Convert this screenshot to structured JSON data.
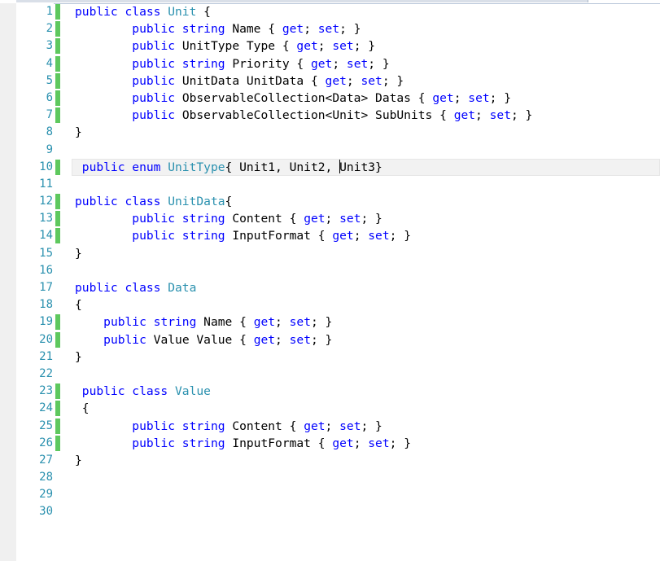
{
  "editor": {
    "lines": [
      {
        "n": "1",
        "changed": true,
        "tokens": [
          {
            "t": "public class ",
            "c": "kw"
          },
          {
            "t": "Unit",
            "c": "ty"
          },
          {
            "t": " {",
            "c": "pl"
          }
        ]
      },
      {
        "n": "2",
        "changed": true,
        "tokens": [
          {
            "t": "        ",
            "c": "pl"
          },
          {
            "t": "public string ",
            "c": "kw"
          },
          {
            "t": "Name { ",
            "c": "pl"
          },
          {
            "t": "get",
            "c": "kw"
          },
          {
            "t": "; ",
            "c": "pl"
          },
          {
            "t": "set",
            "c": "kw"
          },
          {
            "t": "; }",
            "c": "pl"
          }
        ]
      },
      {
        "n": "3",
        "changed": true,
        "tokens": [
          {
            "t": "        ",
            "c": "pl"
          },
          {
            "t": "public ",
            "c": "kw"
          },
          {
            "t": "UnitType Type { ",
            "c": "pl"
          },
          {
            "t": "get",
            "c": "kw"
          },
          {
            "t": "; ",
            "c": "pl"
          },
          {
            "t": "set",
            "c": "kw"
          },
          {
            "t": "; }",
            "c": "pl"
          }
        ]
      },
      {
        "n": "4",
        "changed": true,
        "tokens": [
          {
            "t": "        ",
            "c": "pl"
          },
          {
            "t": "public string ",
            "c": "kw"
          },
          {
            "t": "Priority { ",
            "c": "pl"
          },
          {
            "t": "get",
            "c": "kw"
          },
          {
            "t": "; ",
            "c": "pl"
          },
          {
            "t": "set",
            "c": "kw"
          },
          {
            "t": "; }",
            "c": "pl"
          }
        ]
      },
      {
        "n": "5",
        "changed": true,
        "tokens": [
          {
            "t": "        ",
            "c": "pl"
          },
          {
            "t": "public ",
            "c": "kw"
          },
          {
            "t": "UnitData UnitData { ",
            "c": "pl"
          },
          {
            "t": "get",
            "c": "kw"
          },
          {
            "t": "; ",
            "c": "pl"
          },
          {
            "t": "set",
            "c": "kw"
          },
          {
            "t": "; }",
            "c": "pl"
          }
        ]
      },
      {
        "n": "6",
        "changed": true,
        "tokens": [
          {
            "t": "        ",
            "c": "pl"
          },
          {
            "t": "public ",
            "c": "kw"
          },
          {
            "t": "ObservableCollection<Data> Datas { ",
            "c": "pl"
          },
          {
            "t": "get",
            "c": "kw"
          },
          {
            "t": "; ",
            "c": "pl"
          },
          {
            "t": "set",
            "c": "kw"
          },
          {
            "t": "; }",
            "c": "pl"
          }
        ]
      },
      {
        "n": "7",
        "changed": true,
        "tokens": [
          {
            "t": "        ",
            "c": "pl"
          },
          {
            "t": "public ",
            "c": "kw"
          },
          {
            "t": "ObservableCollection<Unit> SubUnits { ",
            "c": "pl"
          },
          {
            "t": "get",
            "c": "kw"
          },
          {
            "t": "; ",
            "c": "pl"
          },
          {
            "t": "set",
            "c": "kw"
          },
          {
            "t": "; }",
            "c": "pl"
          }
        ]
      },
      {
        "n": "8",
        "changed": false,
        "tokens": [
          {
            "t": "}",
            "c": "pl"
          }
        ]
      },
      {
        "n": "9",
        "changed": false,
        "tokens": []
      },
      {
        "n": "10",
        "changed": true,
        "current": true,
        "tokens": [
          {
            "t": " public enum ",
            "c": "kw"
          },
          {
            "t": "UnitType",
            "c": "ty"
          },
          {
            "t": "{ Unit1, Unit2, ",
            "c": "pl"
          },
          {
            "t": "",
            "c": "caret"
          },
          {
            "t": "Unit3}",
            "c": "pl"
          }
        ]
      },
      {
        "n": "11",
        "changed": false,
        "tokens": []
      },
      {
        "n": "12",
        "changed": true,
        "tokens": [
          {
            "t": "public class ",
            "c": "kw"
          },
          {
            "t": "UnitData",
            "c": "ty"
          },
          {
            "t": "{",
            "c": "pl"
          }
        ]
      },
      {
        "n": "13",
        "changed": true,
        "tokens": [
          {
            "t": "        ",
            "c": "pl"
          },
          {
            "t": "public string ",
            "c": "kw"
          },
          {
            "t": "Content { ",
            "c": "pl"
          },
          {
            "t": "get",
            "c": "kw"
          },
          {
            "t": "; ",
            "c": "pl"
          },
          {
            "t": "set",
            "c": "kw"
          },
          {
            "t": "; }",
            "c": "pl"
          }
        ]
      },
      {
        "n": "14",
        "changed": true,
        "tokens": [
          {
            "t": "        ",
            "c": "pl"
          },
          {
            "t": "public string ",
            "c": "kw"
          },
          {
            "t": "InputFormat { ",
            "c": "pl"
          },
          {
            "t": "get",
            "c": "kw"
          },
          {
            "t": "; ",
            "c": "pl"
          },
          {
            "t": "set",
            "c": "kw"
          },
          {
            "t": "; }",
            "c": "pl"
          }
        ]
      },
      {
        "n": "15",
        "changed": false,
        "tokens": [
          {
            "t": "}",
            "c": "pl"
          }
        ]
      },
      {
        "n": "16",
        "changed": false,
        "tokens": []
      },
      {
        "n": "17",
        "changed": false,
        "tokens": [
          {
            "t": "public class ",
            "c": "kw"
          },
          {
            "t": "Data",
            "c": "ty"
          }
        ]
      },
      {
        "n": "18",
        "changed": false,
        "tokens": [
          {
            "t": "{",
            "c": "pl"
          }
        ]
      },
      {
        "n": "19",
        "changed": true,
        "tokens": [
          {
            "t": "    ",
            "c": "pl"
          },
          {
            "t": "public string ",
            "c": "kw"
          },
          {
            "t": "Name { ",
            "c": "pl"
          },
          {
            "t": "get",
            "c": "kw"
          },
          {
            "t": "; ",
            "c": "pl"
          },
          {
            "t": "set",
            "c": "kw"
          },
          {
            "t": "; }",
            "c": "pl"
          }
        ]
      },
      {
        "n": "20",
        "changed": true,
        "tokens": [
          {
            "t": "    ",
            "c": "pl"
          },
          {
            "t": "public ",
            "c": "kw"
          },
          {
            "t": "Value Value { ",
            "c": "pl"
          },
          {
            "t": "get",
            "c": "kw"
          },
          {
            "t": "; ",
            "c": "pl"
          },
          {
            "t": "set",
            "c": "kw"
          },
          {
            "t": "; }",
            "c": "pl"
          }
        ]
      },
      {
        "n": "21",
        "changed": false,
        "tokens": [
          {
            "t": "}",
            "c": "pl"
          }
        ]
      },
      {
        "n": "22",
        "changed": false,
        "tokens": []
      },
      {
        "n": "23",
        "changed": true,
        "tokens": [
          {
            "t": " public class ",
            "c": "kw"
          },
          {
            "t": "Value",
            "c": "ty"
          }
        ]
      },
      {
        "n": "24",
        "changed": true,
        "tokens": [
          {
            "t": " {",
            "c": "pl"
          }
        ]
      },
      {
        "n": "25",
        "changed": true,
        "tokens": [
          {
            "t": "        ",
            "c": "pl"
          },
          {
            "t": "public string ",
            "c": "kw"
          },
          {
            "t": "Content { ",
            "c": "pl"
          },
          {
            "t": "get",
            "c": "kw"
          },
          {
            "t": "; ",
            "c": "pl"
          },
          {
            "t": "set",
            "c": "kw"
          },
          {
            "t": "; }",
            "c": "pl"
          }
        ]
      },
      {
        "n": "26",
        "changed": true,
        "tokens": [
          {
            "t": "        ",
            "c": "pl"
          },
          {
            "t": "public string ",
            "c": "kw"
          },
          {
            "t": "InputFormat { ",
            "c": "pl"
          },
          {
            "t": "get",
            "c": "kw"
          },
          {
            "t": "; ",
            "c": "pl"
          },
          {
            "t": "set",
            "c": "kw"
          },
          {
            "t": "; }",
            "c": "pl"
          }
        ]
      },
      {
        "n": "27",
        "changed": false,
        "tokens": [
          {
            "t": "}",
            "c": "pl"
          }
        ]
      },
      {
        "n": "28",
        "changed": false,
        "tokens": []
      },
      {
        "n": "29",
        "changed": false,
        "tokens": []
      },
      {
        "n": "30",
        "changed": false,
        "tokens": []
      }
    ]
  }
}
